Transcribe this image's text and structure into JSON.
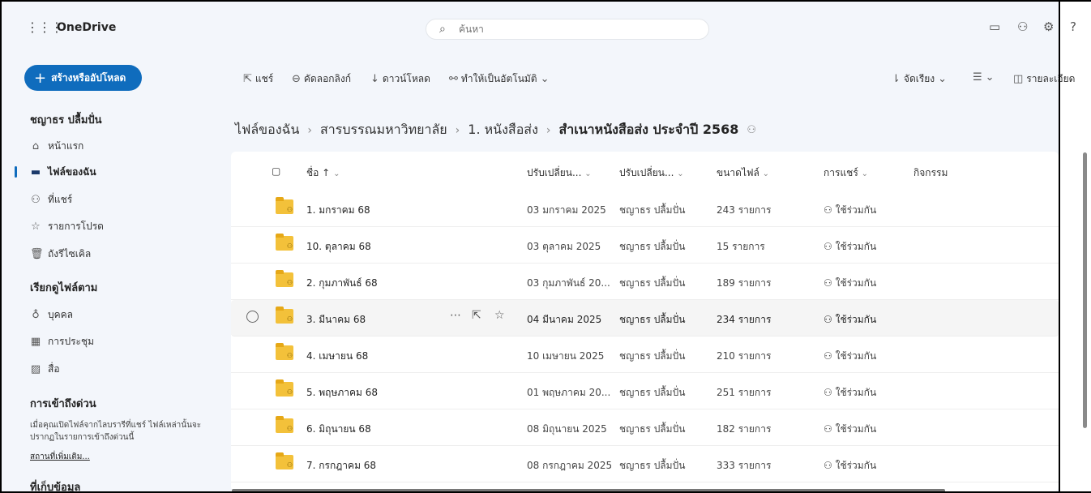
{
  "topbar": {
    "app_name": "OneDrive",
    "search_placeholder": "ค้นหา"
  },
  "commandbar": {
    "create_label": "สร้างหรืออัปโหลด",
    "share": "แชร์",
    "copy_link": "คัดลอกลิงก์",
    "download": "ดาวน์โหลด",
    "automate": "ทำให้เป็นอัตโนมัติ",
    "sort": "จัดเรียง",
    "details": "รายละเอียด"
  },
  "sidebar": {
    "user_name": "ชญาธร ปลื้มปั่น",
    "nav": [
      {
        "label": "หน้าแรก",
        "icon": "home-icon"
      },
      {
        "label": "ไฟล์ของฉัน",
        "icon": "folder-icon"
      },
      {
        "label": "ที่แชร์",
        "icon": "people-icon"
      },
      {
        "label": "รายการโปรด",
        "icon": "star-icon"
      },
      {
        "label": "ถังรีไซเคิล",
        "icon": "trash-icon"
      }
    ],
    "browse_heading": "เรียกดูไฟล์ตาม",
    "browse": [
      {
        "label": "บุคคล",
        "icon": "person-icon"
      },
      {
        "label": "การประชุม",
        "icon": "calendar-icon"
      },
      {
        "label": "สื่อ",
        "icon": "image-icon"
      }
    ],
    "quick_heading": "การเข้าถึงด่วน",
    "quick_text": "เมื่อคุณเปิดไฟล์จากไลบรารีที่แชร์ ไฟล์เหล่านั้นจะปรากฏในรายการเข้าถึงด่วนนี้",
    "more_places": "สถานที่เพิ่มเติม...",
    "storage_heading": "ที่เก็บข้อมูล"
  },
  "breadcrumb": {
    "items": [
      "ไฟล์ของฉัน",
      "สารบรรณมหาวิทยาลัย",
      "1. หนังสือส่ง"
    ],
    "current": "สำเนาหนังสือส่ง ประจำปี 2568"
  },
  "table": {
    "headers": {
      "name": "ชื่อ ↑",
      "modified": "ปรับเปลี่ยน...",
      "modified_by": "ปรับเปลี่ยน...",
      "size": "ขนาดไฟล์",
      "sharing": "การแชร์",
      "activity": "กิจกรรม"
    },
    "rows": [
      {
        "name": "1. มกราคม 68",
        "modified": "03 มกราคม 2025",
        "by": "ชญาธร ปลื้มปั่น",
        "size": "243 รายการ",
        "sharing": "ใช้ร่วมกัน"
      },
      {
        "name": "10. ตุลาคม 68",
        "modified": "03 ตุลาคม 2025",
        "by": "ชญาธร ปลื้มปั่น",
        "size": "15 รายการ",
        "sharing": "ใช้ร่วมกัน"
      },
      {
        "name": "2. กุมภาพันธ์ 68",
        "modified": "03 กุมภาพันธ์ 20...",
        "by": "ชญาธร ปลื้มปั่น",
        "size": "189 รายการ",
        "sharing": "ใช้ร่วมกัน"
      },
      {
        "name": "3. มีนาคม 68",
        "modified": "04 มีนาคม 2025",
        "by": "ชญาธร ปลื้มปั่น",
        "size": "234 รายการ",
        "sharing": "ใช้ร่วมกัน"
      },
      {
        "name": "4. เมษายน 68",
        "modified": "10 เมษายน 2025",
        "by": "ชญาธร ปลื้มปั่น",
        "size": "210 รายการ",
        "sharing": "ใช้ร่วมกัน"
      },
      {
        "name": "5. พฤษภาคม 68",
        "modified": "01 พฤษภาคม 20...",
        "by": "ชญาธร ปลื้มปั่น",
        "size": "251 รายการ",
        "sharing": "ใช้ร่วมกัน"
      },
      {
        "name": "6. มิถุนายน 68",
        "modified": "08 มิถุนายน 2025",
        "by": "ชญาธร ปลื้มปั่น",
        "size": "182 รายการ",
        "sharing": "ใช้ร่วมกัน"
      },
      {
        "name": "7. กรกฎาคม 68",
        "modified": "08 กรกฎาคม 2025",
        "by": "ชญาธร ปลื้มปั่น",
        "size": "333 รายการ",
        "sharing": "ใช้ร่วมกัน"
      }
    ]
  }
}
